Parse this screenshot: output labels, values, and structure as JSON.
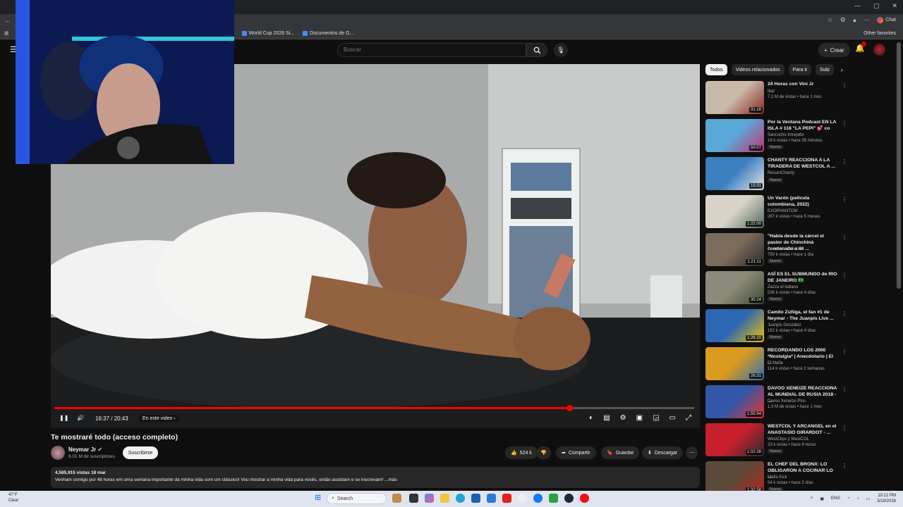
{
  "browser": {
    "bookmarks": [
      {
        "label": "World Cup 2026 Si..."
      },
      {
        "label": "Documentos de G..."
      }
    ],
    "chat_label": "Chat",
    "other_favorites": "Other favorites"
  },
  "youtube": {
    "search_placeholder": "Buscar",
    "create_label": "Crear"
  },
  "player": {
    "current_time": "16:37 / 20:43",
    "chapter_label": "En este video",
    "progress_fraction": 0.805
  },
  "video_info": {
    "title": "Te mostraré todo (acceso completo)",
    "channel_name": "Neymar Jr",
    "subscribers": "6.01 M de suscriptores",
    "subscribe_label": "Suscribirse",
    "likes": "524 k",
    "share_label": "Compartir",
    "save_label": "Guardar",
    "download_label": "Descargar",
    "views_date": "4,585,915 vistas  18 mar",
    "description": "Venham comigo por 48 horas em uma semana importante da minha vida com um clássico! Vou mostrar a minha vida para vocês, então assistam e se inscrevam! ...más"
  },
  "sidebar": {
    "chips": [
      "Todos",
      "Videos relacionados",
      "Para ti",
      "Subi"
    ],
    "recommendations": [
      {
        "title": "24 Horas con Vini Jr",
        "channel": "Ibai",
        "views": "7.2 M de vistas • hace 1 mes",
        "duration": "31:18",
        "nuevo": "",
        "colors": [
          "#c9b9a8",
          "#8a2a22"
        ]
      },
      {
        "title": "Por la Ventana Podcast EN LA ISLA # 118 \"LA PEPI\" 💕 co",
        "channel": "Sancocho Intrepido",
        "views": "16 k vistas • hace 39 minutos",
        "duration": "50:07",
        "nuevo": "Nuevo",
        "colors": [
          "#5aa8d8",
          "#c3316f"
        ]
      },
      {
        "title": "CHANTY REACCIONA A LA TIRADERA DE WESTCOL A ...",
        "channel": "ResumChanty",
        "views": "",
        "duration": "15:31",
        "nuevo": "Nuevo",
        "colors": [
          "#3c7fbf",
          "#e6e6e6"
        ]
      },
      {
        "title": "Un Varón (película colombiana, 2022)",
        "channel": "EXOPHANTOM",
        "views": "287 k vistas • hace 5 meses",
        "duration": "1:22:00",
        "nuevo": "",
        "colors": [
          "#d8d2c8",
          "#4f6c5c"
        ]
      },
      {
        "title": "\"Habla desde la cárcel el pastor de Chinchiná condenado a 40 ...",
        "channel": "Conducta Delictiva",
        "views": "793 k vistas • hace 1 día",
        "duration": "1:21:11",
        "nuevo": "Nuevo",
        "colors": [
          "#7b6b5a",
          "#2a2a2a"
        ]
      },
      {
        "title": "ASÍ ES EL SUBMUNDO de RIO DE JANEIRO 🇧🇷",
        "channel": "Zazza el italiano",
        "views": "536 k vistas • hace 4 días",
        "duration": "35:24",
        "nuevo": "Nuevo",
        "colors": [
          "#8c8a7a",
          "#3a4b2c"
        ]
      },
      {
        "title": "Camilo Zúñiga, el fan #1 de Neymar - The Juanpis Live ...",
        "channel": "Juanpis González",
        "views": "152 k vistas • hace 4 días",
        "duration": "1:26:20",
        "nuevo": "Nuevo",
        "colors": [
          "#2d66b2",
          "#f0c400"
        ]
      },
      {
        "title": "RECORDANDO LOS 2000 *Nostalgia* | Anecdotario | El ...",
        "channel": "El Mañe",
        "views": "114 k vistas • hace 2 semanas",
        "duration": "26:31",
        "nuevo": "",
        "colors": [
          "#d99a1f",
          "#2f6fb2"
        ]
      },
      {
        "title": "DAVOO XENEIZE REACCIONA AL MUNDIAL DE RUSIA 2018 - ...",
        "channel": "Davoo Xeneize Plus",
        "views": "1.3 M de vistas • hace 1 mes",
        "duration": "1:55:54",
        "nuevo": "",
        "colors": [
          "#3357a8",
          "#e8312e"
        ]
      },
      {
        "title": "WESTCOL Y ARCANGEL en el ANASTASIO GIRARDOT - ...",
        "channel": "WestClips y WestCOL",
        "views": "23 k vistas • hace 9 horas",
        "duration": "1:02:28",
        "nuevo": "Nuevo",
        "colors": [
          "#c81f2c",
          "#2b2b2b"
        ]
      },
      {
        "title": "EL CHEF DEL BRONX: LO OBLIGARON A COCINAR LO ...",
        "channel": "Mafia Kick",
        "views": "54 k vistas • hace 2 días",
        "duration": "1:32:58",
        "nuevo": "Nuevo",
        "colors": [
          "#5b4a3a",
          "#b52620"
        ]
      }
    ]
  },
  "taskbar": {
    "weather_temp": "47°F",
    "weather_desc": "Clear",
    "search_label": "Search",
    "language": "ENG",
    "time": "10:12 PM",
    "date": "3/19/2026"
  }
}
